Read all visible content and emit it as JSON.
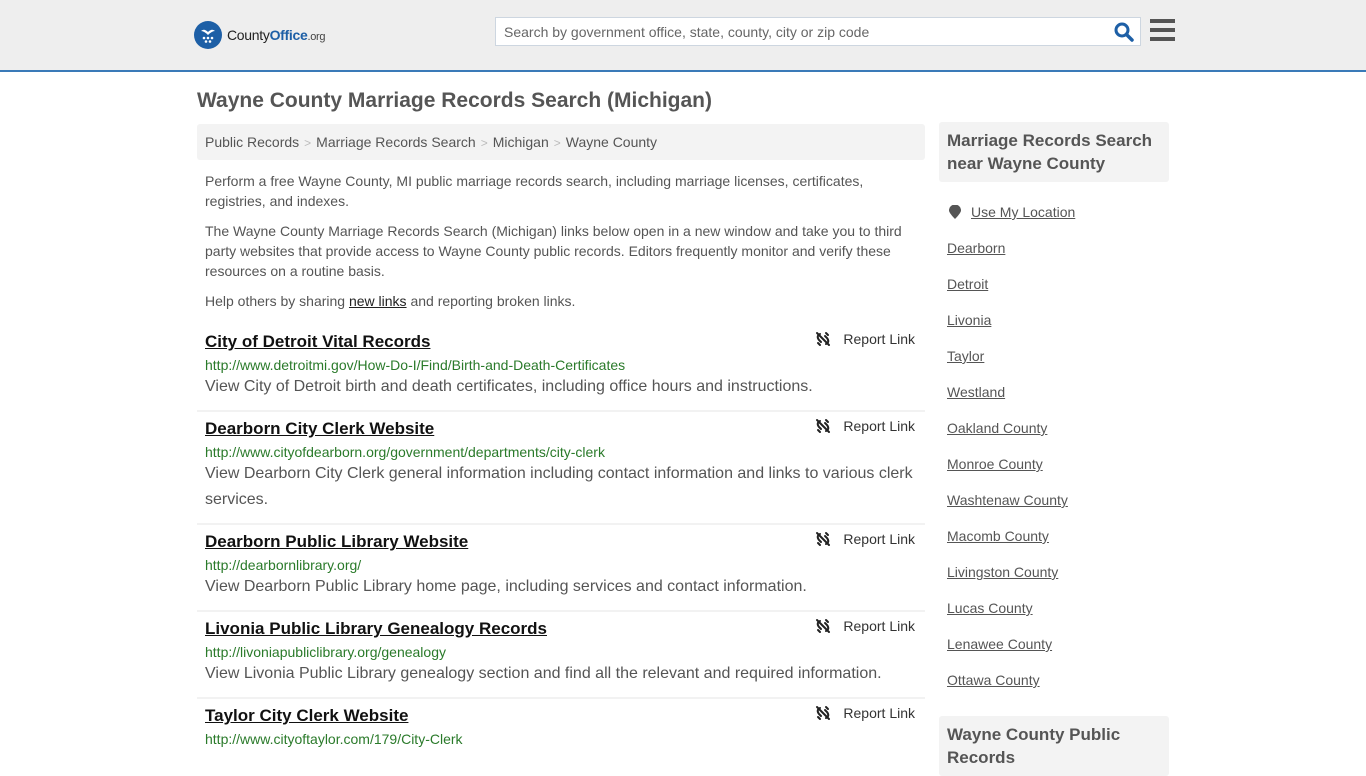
{
  "header": {
    "logo": {
      "name_part1": "County",
      "name_part2": "Office",
      "name_part3": ".org"
    },
    "search": {
      "placeholder": "Search by government office, state, county, city or zip code",
      "value": ""
    },
    "icons": {
      "search": "search-icon",
      "menu": "hamburger-menu-icon",
      "logo": "eagle-stars-logo-icon"
    }
  },
  "page": {
    "title": "Wayne County Marriage Records Search (Michigan)",
    "breadcrumb": [
      "Public Records",
      "Marriage Records Search",
      "Michigan",
      "Wayne County"
    ],
    "intro": {
      "p1": "Perform a free Wayne County, MI public marriage records search, including marriage licenses, certificates, registries, and indexes.",
      "p2": "The Wayne County Marriage Records Search (Michigan) links below open in a new window and take you to third party websites that provide access to Wayne County public records. Editors frequently monitor and verify these resources on a routine basis.",
      "p3_before": "Help others by sharing ",
      "p3_link": "new links",
      "p3_after": " and reporting broken links."
    }
  },
  "results": [
    {
      "title": "City of Detroit Vital Records",
      "url": "http://www.detroitmi.gov/How-Do-I/Find/Birth-and-Death-Certificates",
      "description": "View City of Detroit birth and death certificates, including office hours and instructions.",
      "report_label": "Report Link"
    },
    {
      "title": "Dearborn City Clerk Website",
      "url": "http://www.cityofdearborn.org/government/departments/city-clerk",
      "description": "View Dearborn City Clerk general information including contact information and links to various clerk services.",
      "report_label": "Report Link"
    },
    {
      "title": "Dearborn Public Library Website",
      "url": "http://dearbornlibrary.org/",
      "description": "View Dearborn Public Library home page, including services and contact information.",
      "report_label": "Report Link"
    },
    {
      "title": "Livonia Public Library Genealogy Records",
      "url": "http://livoniapubliclibrary.org/genealogy",
      "description": "View Livonia Public Library genealogy section and find all the relevant and required information.",
      "report_label": "Report Link"
    },
    {
      "title": "Taylor City Clerk Website",
      "url": "http://www.cityoftaylor.com/179/City-Clerk",
      "description": "",
      "report_label": "Report Link"
    }
  ],
  "sidebar": {
    "nearby_heading": "Marriage Records Search near Wayne County",
    "use_location": "Use My Location",
    "nearby": [
      "Dearborn",
      "Detroit",
      "Livonia",
      "Taylor",
      "Westland",
      "Oakland County",
      "Monroe County",
      "Washtenaw County",
      "Macomb County",
      "Livingston County",
      "Lucas County",
      "Lenawee County",
      "Ottawa County"
    ],
    "public_records_heading": "Wayne County Public Records"
  },
  "colors": {
    "accent": "#1d5fa6",
    "url_green": "#2a7a2a",
    "topbar_bg": "#eeeeee",
    "topbar_border": "#3a7ab8"
  }
}
